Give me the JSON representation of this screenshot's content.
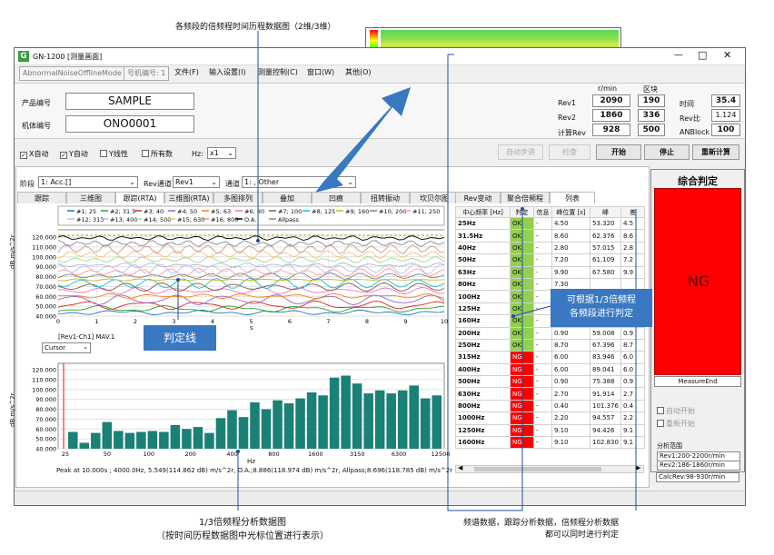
{
  "annotations": {
    "top": "各频段的倍频程时间历程数据图（2维/3维）",
    "judgement_line": "判定线",
    "by_band": [
      "可根据1/3倍频程",
      "各频段进行判定"
    ],
    "bottom_left": [
      "1/3倍频程分析数据图",
      "（按时间历程数据图中光标位置进行表示）"
    ],
    "bottom_right": [
      "频谱数据，跟踪分析数据，倍频程分析数据",
      "都可以同时进行判定"
    ]
  },
  "window": {
    "title": "GN-1200 [测量画面]",
    "mode_box": "AbnormalNoiseOfflineMode",
    "channel_box": "号机编号: 1",
    "menu": [
      "文件(F)",
      "输入设置(I)",
      "测量控制(C)",
      "窗口(W)",
      "其他(O)"
    ]
  },
  "product": {
    "name_label": "产品编号",
    "name_value": "SAMPLE",
    "machine_label": "机体编号",
    "machine_value": "ONO0001"
  },
  "rev_panel": {
    "header_rmin": "r/min",
    "header_block": "区块",
    "rows": [
      {
        "label": "Rev1",
        "rmin": "2090",
        "block": "190"
      },
      {
        "label": "Rev2",
        "rmin": "1860",
        "block": "336"
      },
      {
        "label": "计算Rev",
        "rmin": "928",
        "block": "500"
      }
    ],
    "time_label": "时间",
    "time_value": "35.4",
    "ratio_label": "Rev比",
    "ratio_value": "1.124",
    "anblock_label": "ANBlock",
    "anblock_value": "100"
  },
  "options": {
    "x_auto": "X自动",
    "y_auto": "Y自动",
    "y_linear": "Y线性",
    "all": "所有数",
    "hz_label": "Hz:",
    "hz_value": "x1"
  },
  "buttons": {
    "auto_sync": "自动步进",
    "check": "检查",
    "start": "开始",
    "stop": "停止",
    "recalc": "重新计算"
  },
  "selectors": {
    "stage_label": "阶段",
    "stage_value": "1: Acc.[]",
    "rev_label": "Rev通道",
    "rev_value": "Rev1",
    "ch_label": "通道",
    "ch_value": "1: , Other"
  },
  "tabs_left": [
    "跟踪",
    "三维图",
    "跟踪(RTA)",
    "三维图(RTA)",
    "多图排列",
    "叠加",
    "凹痕",
    "扭转振动",
    "坎贝尔图"
  ],
  "tabs_right": [
    "Rev变动",
    "聚合倍频程",
    "列表"
  ],
  "legend": [
    "#1; 25",
    "#2; 31.5",
    "#3; 40",
    "#4; 50",
    "#5; 63",
    "#6; 80",
    "#7; 100",
    "#8; 125",
    "#9; 160",
    "#10; 200",
    "#11; 250",
    "#12; 315",
    "#13; 400",
    "#14; 500",
    "#15; 630",
    "#16; 800",
    "O.A.",
    "Allpass"
  ],
  "legend_colors": [
    "#1f77b4",
    "#2ca02c",
    "#d62728",
    "#9467bd",
    "#ff7f0e",
    "#e377c2",
    "#8c564b",
    "#17becf",
    "#bcbd22",
    "#7f7f7f",
    "#ff9896",
    "#aec7e8",
    "#c5b0d5",
    "#98df8a",
    "#ffbb78",
    "#c49c94",
    "#000000",
    "#888888"
  ],
  "upper_chart": {
    "ylabel": "dB m/s^2r",
    "xlabel": "s",
    "yticks": [
      "120.000",
      "110.000",
      "100.000",
      "90.000",
      "80.000",
      "70.000",
      "60.000",
      "50.000",
      "40.000"
    ],
    "xticks": [
      "0",
      "1",
      "2",
      "3",
      "4",
      "5",
      "6",
      "7",
      "8",
      "9",
      "10"
    ],
    "cursor_label": "[Rev1-Ch1] MAV.1",
    "cursor_select": "Cursor"
  },
  "chart_data": {
    "type": "bar",
    "ylabel": "dB m/s^2r",
    "xlabel": "Hz",
    "ylim": [
      40,
      120
    ],
    "yticks": [
      "120.000",
      "110.000",
      "100.000",
      "90.000",
      "80.000",
      "70.000",
      "60.000",
      "50.000",
      "40.000"
    ],
    "xticks": [
      "25",
      "50",
      "100",
      "200",
      "400",
      "800",
      "1600",
      "3150",
      "6300",
      "12500"
    ],
    "values": [
      57,
      46,
      56,
      67,
      58,
      56,
      57,
      58,
      57,
      64,
      60,
      62,
      56,
      71,
      79,
      72,
      87,
      80,
      89,
      86,
      91,
      97,
      94,
      112,
      114,
      106,
      96,
      99,
      96,
      99,
      104,
      91,
      94
    ],
    "footer": "Peak at 10.000s ; 4000.0Hz, 5.549(114.862 dB) m/s^2r, O.A.;8.886(118.974 dB) m/s^2r, Allpass;8.696(118.785 dB) m/s^2r"
  },
  "table": {
    "headers": [
      "中心频率 [Hz]",
      "判定",
      "信息",
      "峰位置 [s]",
      "峰",
      "差"
    ],
    "rows": [
      [
        "25Hz",
        "OK",
        "-",
        "4.50",
        "53.320",
        "4.5"
      ],
      [
        "31.5Hz",
        "OK",
        "-",
        "8.60",
        "62.376",
        "8.6"
      ],
      [
        "40Hz",
        "OK",
        "-",
        "2.80",
        "57.015",
        "2.8"
      ],
      [
        "50Hz",
        "OK",
        "-",
        "7.20",
        "61.109",
        "7.2"
      ],
      [
        "63Hz",
        "OK",
        "-",
        "9.90",
        "67.580",
        "9.9"
      ],
      [
        "80Hz",
        "OK",
        "-",
        "7.30",
        "",
        ""
      ],
      [
        "100Hz",
        "OK",
        "-",
        "7.60",
        "",
        ""
      ],
      [
        "125Hz",
        "OK",
        "-",
        "8.40",
        "",
        ""
      ],
      [
        "160Hz",
        "OK",
        "-",
        "9.90",
        "",
        ""
      ],
      [
        "200Hz",
        "OK",
        "-",
        "0.90",
        "59.008",
        "0.9"
      ],
      [
        "250Hz",
        "OK",
        "-",
        "8.70",
        "67.396",
        "8.7"
      ],
      [
        "315Hz",
        "NG",
        "-",
        "6.00",
        "83.946",
        "6.0"
      ],
      [
        "400Hz",
        "NG",
        "-",
        "6.00",
        "89.041",
        "6.0"
      ],
      [
        "500Hz",
        "NG",
        "-",
        "0.90",
        "75.388",
        "0.9"
      ],
      [
        "630Hz",
        "NG",
        "-",
        "2.70",
        "91.914",
        "2.7"
      ],
      [
        "800Hz",
        "NG",
        "-",
        "0.40",
        "101.376",
        "0.4"
      ],
      [
        "1000Hz",
        "NG",
        "-",
        "2.20",
        "94.557",
        "2.2"
      ],
      [
        "1250Hz",
        "NG",
        "-",
        "9.10",
        "94.426",
        "9.1"
      ],
      [
        "1600Hz",
        "NG",
        "-",
        "9.10",
        "102.830",
        "9.1"
      ]
    ]
  },
  "judgement": {
    "title": "综合判定",
    "result": "NG",
    "status": "MeasureEnd",
    "auto_start": "自动开始",
    "restart": "重新开始",
    "range_title": "分析范围",
    "ranges": [
      "Rev1:200-2200r/min",
      "Rev2:186-1860r/min",
      "CalcRev:98-930r/min"
    ]
  }
}
